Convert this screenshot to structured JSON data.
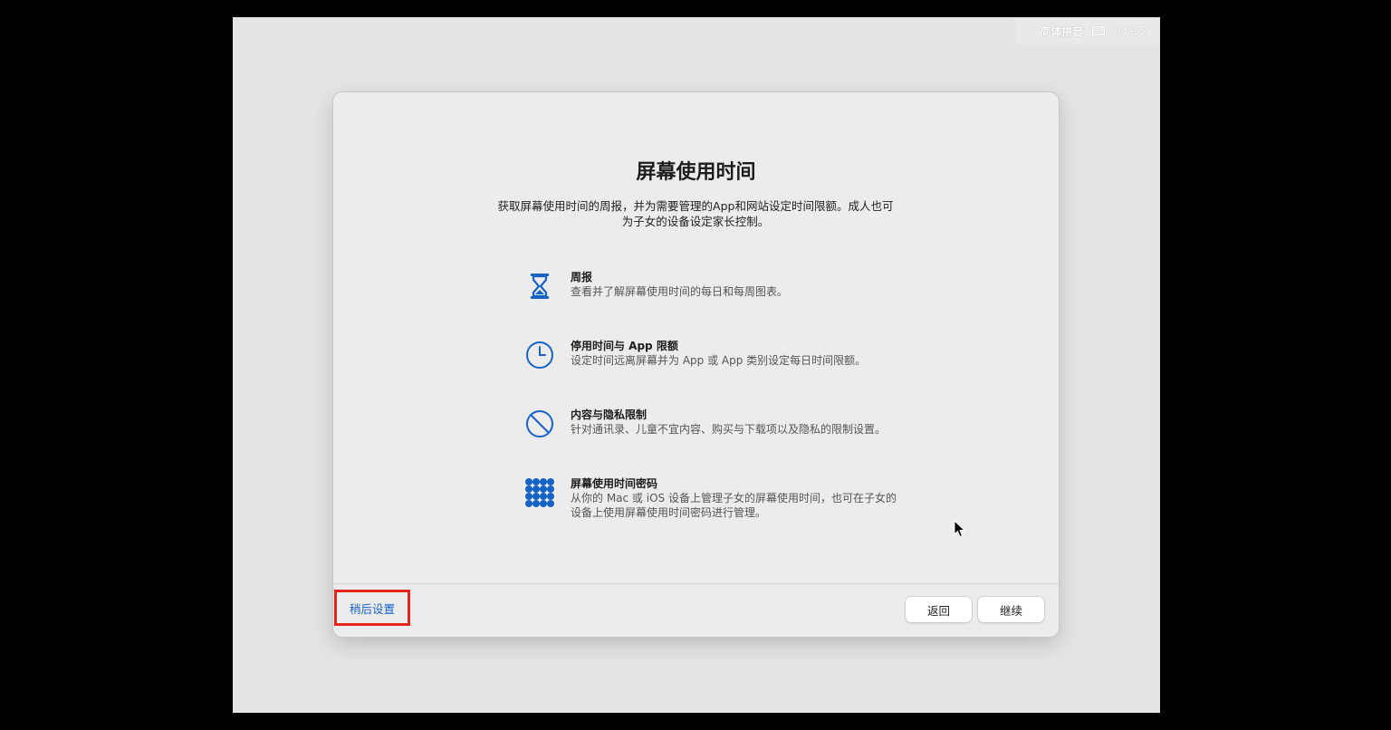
{
  "menubar": {
    "input_method": "简体拼音",
    "keyboard_icon": "keyboard-icon",
    "time": "03:15"
  },
  "dialog": {
    "title": "屏幕使用时间",
    "subtitle": "获取屏幕使用时间的周报，并为需要管理的App和网站设定时间限额。成人也可为子女的设备设定家长控制。",
    "features": [
      {
        "icon": "hourglass-icon",
        "title": "周报",
        "desc": "查看并了解屏幕使用时间的每日和每周图表。"
      },
      {
        "icon": "clock-icon",
        "title": "停用时间与 App 限额",
        "desc": "设定时间远离屏幕并为 App 或 App 类别设定每日时间限额。"
      },
      {
        "icon": "restriction-icon",
        "title": "内容与隐私限制",
        "desc": "针对通讯录、儿童不宜内容、购买与下载项以及隐私的限制设置。"
      },
      {
        "icon": "keypad-icon",
        "title": "屏幕使用时间密码",
        "desc": "从你的 Mac 或 iOS 设备上管理子女的屏幕使用时间，也可在子女的设备上使用屏幕使用时间密码进行管理。"
      }
    ],
    "later_label": "稍后设置",
    "back_label": "返回",
    "continue_label": "继续"
  },
  "colors": {
    "accent": "#1860c6",
    "highlight_border": "#e3261c",
    "icon_blue": "#1763c5"
  }
}
